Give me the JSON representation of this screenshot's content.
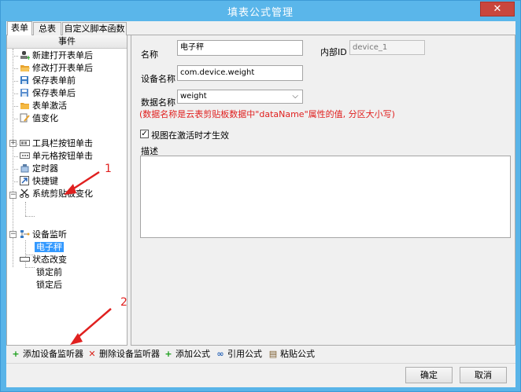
{
  "window": {
    "title": "填表公式管理",
    "close_icon": "close-icon"
  },
  "tabs": [
    {
      "label": "表单",
      "active": true
    },
    {
      "label": "总表",
      "active": false
    },
    {
      "label": "自定义脚本函数",
      "active": false
    }
  ],
  "left_panel": {
    "header": "事件",
    "events": [
      {
        "label": "新建打开表单后",
        "icon": "new-open-icon"
      },
      {
        "label": "修改打开表单后",
        "icon": "folder-open-icon"
      },
      {
        "label": "保存表单前",
        "icon": "save-before-icon"
      },
      {
        "label": "保存表单后",
        "icon": "save-after-icon"
      },
      {
        "label": "表单激活",
        "icon": "folder-icon"
      },
      {
        "label": "值变化",
        "icon": "value-change-icon"
      },
      {
        "label": "工具栏按钮单击",
        "icon": "toolbar-icon"
      },
      {
        "label": "单元格按钮单击",
        "icon": "cell-button-icon"
      },
      {
        "label": "定时器",
        "icon": "timer-icon"
      },
      {
        "label": "快捷键",
        "icon": "shortcut-icon"
      },
      {
        "label": "系统剪贴板变化",
        "icon": "scissors-icon"
      },
      {
        "label": "设备监听",
        "icon": "device-monitor-icon"
      },
      {
        "label": "电子秤",
        "selected": true
      },
      {
        "label": "状态改变",
        "icon": "state-icon"
      },
      {
        "label": "锁定前"
      },
      {
        "label": "锁定后"
      }
    ]
  },
  "form": {
    "name_label": "名称",
    "name_value": "电子秤",
    "internal_id_label": "内部ID",
    "internal_id_value": "device_1",
    "device_name_label": "设备名称",
    "device_name_value": "com.device.weight",
    "data_name_label": "数据名称",
    "data_name_value": "weight",
    "hint": "(数据名称是云表剪贴板数据中\"dataName\"属性的值, 分区大小写)",
    "checkbox_label": "视图在激活时才生效",
    "checkbox_checked": true,
    "description_label": "描述",
    "description_value": ""
  },
  "toolbar": {
    "add_listener": "添加设备监听器",
    "delete_listener": "删除设备监听器",
    "add_formula": "添加公式",
    "reference_formula": "引用公式",
    "paste_formula": "粘贴公式"
  },
  "buttons": {
    "ok": "确定",
    "cancel": "取消"
  },
  "annotations": {
    "one": "1",
    "two": "2"
  },
  "colors": {
    "title_bar": "#5ab6ea",
    "close": "#c9463d",
    "hint": "#e0201f",
    "selection": "#3399ff"
  }
}
